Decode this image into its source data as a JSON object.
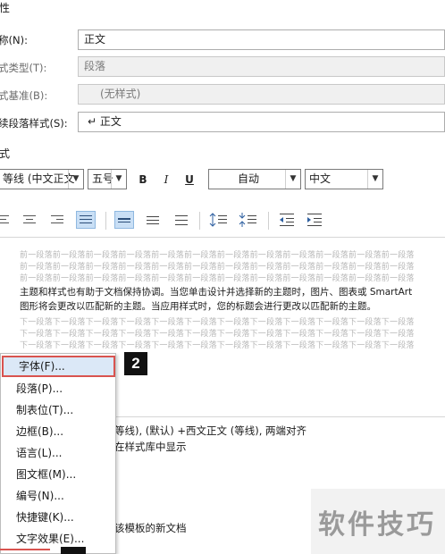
{
  "section_properties_title": "性",
  "fields": {
    "name": {
      "label": "称(N):",
      "value": "正文"
    },
    "style_type": {
      "label": "式类型(T):",
      "value": "段落"
    },
    "based_on": {
      "label": "式基准(B):",
      "value": "(无样式)"
    },
    "next_style": {
      "label": "续段落样式(S):",
      "value": "↵ 正文"
    }
  },
  "section_format_title": "式",
  "toolbar": {
    "font": "等线 (中文正文",
    "size": "五号",
    "bold": "B",
    "italic": "I",
    "underline": "U",
    "color": "自动",
    "language": "中文"
  },
  "preview": {
    "before_lines": [
      "前一段落前一段落前一段落前一段落前一段落前一段落前一段落前一段落前一段落前一段落前一段落前一段落",
      "前一段落前一段落前一段落前一段落前一段落前一段落前一段落前一段落前一段落前一段落前一段落前一段落",
      "前一段落前一段落前一段落前一段落前一段落前一段落前一段落前一段落前一段落前一段落前一段落前一段落"
    ],
    "sample_lines": [
      "主题和样式也有助于文档保持协调。当您单击设计并选择新的主题时，图片、图表或 SmartArt",
      "图形将会更改以匹配新的主题。当应用样式时，您的标题会进行更改以匹配新的主题。"
    ],
    "after_lines": [
      "下一段落下一段落下一段落下一段落下一段落下一段落下一段落下一段落下一段落下一段落下一段落下一段落",
      "下一段落下一段落下一段落下一段落下一段落下一段落下一段落下一段落下一段落下一段落下一段落下一段落",
      "下一段落下一段落下一段落下一段落下一段落下一段落下一段落下一段落下一段落下一段落下一段落下一段落"
    ]
  },
  "description": {
    "line1": "等线), (默认) +西文正文 (等线), 两端对齐",
    "line2": "在样式库中显示"
  },
  "template_option": "该模板的新文档",
  "context_menu": [
    "字体(F)...",
    "段落(P)...",
    "制表位(T)...",
    "边框(B)...",
    "语言(L)...",
    "图文框(M)...",
    "编号(N)...",
    "快捷键(K)...",
    "文字效果(E)..."
  ],
  "step_badge": "2",
  "watermark": "软件技巧",
  "colors": {
    "highlight_border": "#d9534f",
    "menu_hover": "#dbe8f7",
    "active_button": "#c9dff5"
  }
}
